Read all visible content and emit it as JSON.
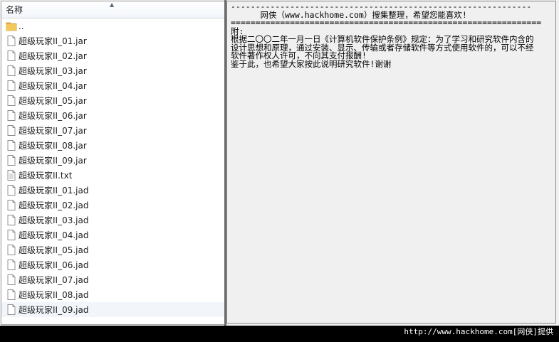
{
  "file_pane": {
    "column_header": "名称",
    "items": [
      {
        "name": "..",
        "icon": "folder-icon",
        "selected": false
      },
      {
        "name": "超级玩家II_01.jar",
        "icon": "file-icon",
        "selected": false
      },
      {
        "name": "超级玩家II_02.jar",
        "icon": "file-icon",
        "selected": false
      },
      {
        "name": "超级玩家II_03.jar",
        "icon": "file-icon",
        "selected": false
      },
      {
        "name": "超级玩家II_04.jar",
        "icon": "file-icon",
        "selected": false
      },
      {
        "name": "超级玩家II_05.jar",
        "icon": "file-icon",
        "selected": false
      },
      {
        "name": "超级玩家II_06.jar",
        "icon": "file-icon",
        "selected": false
      },
      {
        "name": "超级玩家II_07.jar",
        "icon": "file-icon",
        "selected": false
      },
      {
        "name": "超级玩家II_08.jar",
        "icon": "file-icon",
        "selected": false
      },
      {
        "name": "超级玩家II_09.jar",
        "icon": "file-icon",
        "selected": false
      },
      {
        "name": "超级玩家II.txt",
        "icon": "text-file-icon",
        "selected": false
      },
      {
        "name": "超级玩家II_01.jad",
        "icon": "file-icon",
        "selected": false
      },
      {
        "name": "超级玩家II_02.jad",
        "icon": "file-icon",
        "selected": false
      },
      {
        "name": "超级玩家II_03.jad",
        "icon": "file-icon",
        "selected": false
      },
      {
        "name": "超级玩家II_04.jad",
        "icon": "file-icon",
        "selected": false
      },
      {
        "name": "超级玩家II_05.jad",
        "icon": "file-icon",
        "selected": false
      },
      {
        "name": "超级玩家II_06.jad",
        "icon": "file-icon",
        "selected": false
      },
      {
        "name": "超级玩家II_07.jad",
        "icon": "file-icon",
        "selected": false
      },
      {
        "name": "超级玩家II_08.jad",
        "icon": "file-icon",
        "selected": false
      },
      {
        "name": "超级玩家II_09.jad",
        "icon": "file-icon",
        "selected": true
      }
    ]
  },
  "text_pane": {
    "lines": [
      "-------------------------------------------------------------",
      "      网侠（www.hackhome.com）搜集整理，希望您能喜欢!",
      "===============================================================",
      "附:",
      "根据二〇〇二年一月一日《计算机软件保护条例》规定：为了学习和研究软件内含的",
      "设计思想和原理，通过安装、显示、传输或者存储软件等方式使用软件的，可以不经",
      "软件著作权人许可，不向其支付报酬!",
      "鉴于此，也希望大家按此说明研究软件!谢谢"
    ]
  },
  "watermark": "http://www.hackhome.com[网侠]提供",
  "colors": {
    "window_bg": "#f0f0f0",
    "list_bg": "#ffffff",
    "selected_row_bg": "#f2f6fb",
    "folder": "#e8b53a",
    "outer_bg": "#000000"
  }
}
